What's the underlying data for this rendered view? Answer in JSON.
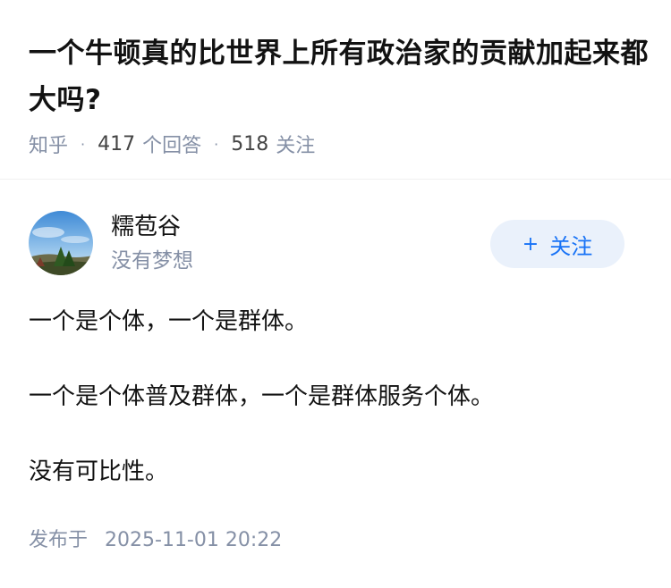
{
  "question": {
    "title": "一个牛顿真的比世界上所有政治家的贡献加起来都大吗?",
    "source": "知乎",
    "answers_count": "417",
    "answers_label": "个回答",
    "followers_count": "518",
    "followers_label": "关注"
  },
  "author": {
    "name": "糯苞谷",
    "headline": "没有梦想",
    "avatar_icon": "avatar-landscape-icon"
  },
  "follow_button": {
    "icon": "+",
    "label": "关注"
  },
  "answer": {
    "paragraphs": [
      "一个是个体，一个是群体。",
      "一个是个体普及群体，一个是群体服务个体。",
      "没有可比性。"
    ]
  },
  "publish": {
    "label": "发布于",
    "datetime": "2025-11-01 20:22"
  },
  "colors": {
    "accent": "#1772f6",
    "follow_bg": "#eaf1fb",
    "muted_text": "#8590a6",
    "primary_text": "#121212"
  }
}
